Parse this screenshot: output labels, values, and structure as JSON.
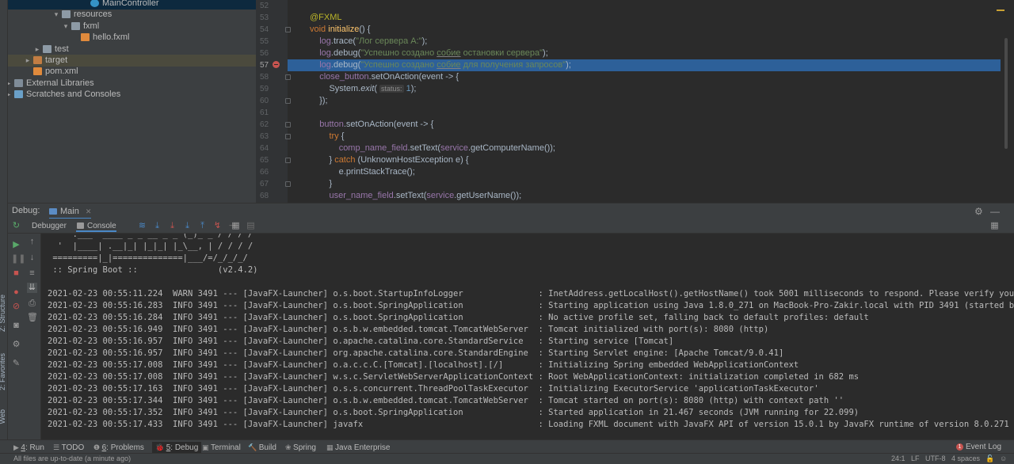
{
  "side_tabs": {
    "structure": "Z: Structure",
    "favorites": "2: Favorites",
    "web": "Web"
  },
  "project_tree": [
    {
      "label": "MainController",
      "icon": "class-icon",
      "depth": 8,
      "arrow": "",
      "state": "selected"
    },
    {
      "label": "resources",
      "icon": "folder-icon",
      "depth": 5,
      "arrow": "▾",
      "state": ""
    },
    {
      "label": "fxml",
      "icon": "folder-icon",
      "depth": 6,
      "arrow": "▾",
      "state": ""
    },
    {
      "label": "hello.fxml",
      "icon": "xml-file-icon",
      "depth": 7,
      "arrow": "",
      "state": ""
    },
    {
      "label": "test",
      "icon": "folder-icon",
      "depth": 3,
      "arrow": "▸",
      "state": ""
    },
    {
      "label": "target",
      "icon": "folder-orange-icon",
      "depth": 2,
      "arrow": "▸",
      "state": "highlight"
    },
    {
      "label": "pom.xml",
      "icon": "maven-icon",
      "depth": 2,
      "arrow": "",
      "state": ""
    },
    {
      "label": "External Libraries",
      "icon": "library-icon",
      "depth": 0,
      "arrow": "▸",
      "state": ""
    },
    {
      "label": "Scratches and Consoles",
      "icon": "scratch-icon",
      "depth": 0,
      "arrow": "▸",
      "state": ""
    }
  ],
  "editor": {
    "line_numbers": [
      "52",
      "53",
      "54",
      "55",
      "56",
      "57",
      "58",
      "59",
      "60",
      "61",
      "62",
      "63",
      "64",
      "65",
      "66",
      "67",
      "68"
    ],
    "current_line": "57"
  },
  "debug": {
    "title": "Debug:",
    "run_config": "Main",
    "tab_debugger": "Debugger",
    "tab_console": "Console"
  },
  "console_lines": [
    "   ' .___  ____ _ _ __ _ _ (_)_ _ / / / /",
    "  '  |____| .__|_| |_|_| |_\\__, | / / / /",
    " =========|_|==============|___/=/_/_/_/",
    " :: Spring Boot ::                (v2.4.2)",
    "",
    "2021-02-23 00:55:11.224  WARN 3491 --- [JavaFX-Launcher] o.s.boot.StartupInfoLogger               : InetAddress.getLocalHost().getHostName() took 5001 milliseconds to respond. Please verify your network configur",
    "2021-02-23 00:55:16.283  INFO 3491 --- [JavaFX-Launcher] o.s.boot.SpringApplication               : Starting application using Java 1.8.0_271 on MacBook-Pro-Zakir.local with PID 3491 (started by zakirayubov in /",
    "2021-02-23 00:55:16.284  INFO 3491 --- [JavaFX-Launcher] o.s.boot.SpringApplication               : No active profile set, falling back to default profiles: default",
    "2021-02-23 00:55:16.949  INFO 3491 --- [JavaFX-Launcher] o.s.b.w.embedded.tomcat.TomcatWebServer  : Tomcat initialized with port(s): 8080 (http)",
    "2021-02-23 00:55:16.957  INFO 3491 --- [JavaFX-Launcher] o.apache.catalina.core.StandardService   : Starting service [Tomcat]",
    "2021-02-23 00:55:16.957  INFO 3491 --- [JavaFX-Launcher] org.apache.catalina.core.StandardEngine  : Starting Servlet engine: [Apache Tomcat/9.0.41]",
    "2021-02-23 00:55:17.008  INFO 3491 --- [JavaFX-Launcher] o.a.c.c.C.[Tomcat].[localhost].[/]       : Initializing Spring embedded WebApplicationContext",
    "2021-02-23 00:55:17.008  INFO 3491 --- [JavaFX-Launcher] w.s.c.ServletWebServerApplicationContext : Root WebApplicationContext: initialization completed in 682 ms",
    "2021-02-23 00:55:17.163  INFO 3491 --- [JavaFX-Launcher] o.s.s.concurrent.ThreadPoolTaskExecutor  : Initializing ExecutorService 'applicationTaskExecutor'",
    "2021-02-23 00:55:17.344  INFO 3491 --- [JavaFX-Launcher] o.s.b.w.embedded.tomcat.TomcatWebServer  : Tomcat started on port(s): 8080 (http) with context path ''",
    "2021-02-23 00:55:17.352  INFO 3491 --- [JavaFX-Launcher] o.s.boot.SpringApplication               : Started application in 21.467 seconds (JVM running for 22.099)",
    "2021-02-23 00:55:17.433  INFO 3491 --- [JavaFX-Launcher] javafx                                   : Loading FXML document with JavaFX API of version 15.0.1 by JavaFX runtime of version 8.0.271"
  ],
  "bottom_tools": [
    {
      "num": "4",
      "label": ": Run",
      "icon": "run-icon",
      "active": false
    },
    {
      "num": "",
      "label": "TODO",
      "icon": "todo-icon",
      "active": false
    },
    {
      "num": "6",
      "label": ": Problems",
      "icon": "problems-icon",
      "active": false
    },
    {
      "num": "5",
      "label": ": Debug",
      "icon": "debug-icon",
      "active": true
    },
    {
      "num": "",
      "label": "Terminal",
      "icon": "terminal-icon",
      "active": false
    },
    {
      "num": "",
      "label": "Build",
      "icon": "build-icon",
      "active": false
    },
    {
      "num": "",
      "label": "Spring",
      "icon": "spring-icon",
      "active": false
    },
    {
      "num": "",
      "label": "Java Enterprise",
      "icon": "java-enterprise-icon",
      "active": false
    }
  ],
  "event_log": {
    "badge": "1",
    "label": "Event Log"
  },
  "status_bar": {
    "message": "All files are up-to-date (a minute ago)",
    "position": "24:1",
    "line_sep": "LF",
    "encoding": "UTF-8",
    "indent": "4 spaces"
  },
  "colors": {
    "current_line": "#2d6099",
    "keyword": "#cc7832",
    "string": "#6a8759",
    "annotation": "#bbb529",
    "breakpoint": "#c75450"
  }
}
